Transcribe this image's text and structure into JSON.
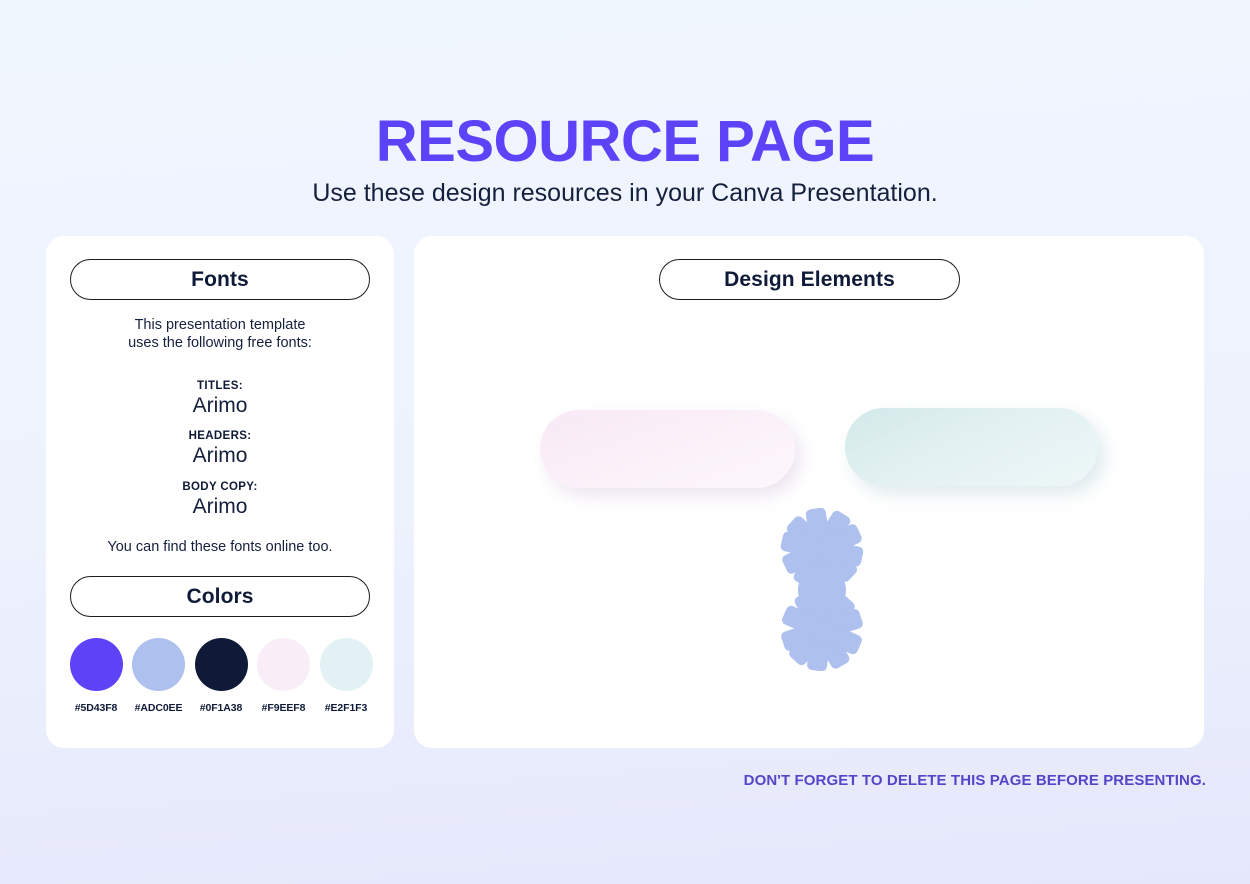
{
  "header": {
    "title": "RESOURCE PAGE",
    "subtitle": "Use these design resources in your Canva Presentation."
  },
  "fonts_card": {
    "heading": "Fonts",
    "intro": "This presentation template\nuses the following free fonts:",
    "groups": [
      {
        "label": "TITLES:",
        "value": "Arimo"
      },
      {
        "label": "HEADERS:",
        "value": "Arimo"
      },
      {
        "label": "BODY COPY:",
        "value": "Arimo"
      }
    ],
    "outro": "You can find these fonts online too."
  },
  "colors_card": {
    "heading": "Colors",
    "swatches": [
      {
        "hex": "#5D43F8",
        "label": "#5D43F8"
      },
      {
        "hex": "#ADC0EE",
        "label": "#ADC0EE"
      },
      {
        "hex": "#0F1A38",
        "label": "#0F1A38"
      },
      {
        "hex": "#F9EEF8",
        "label": "#F9EEF8"
      },
      {
        "hex": "#E2F1F3",
        "label": "#E2F1F3"
      }
    ]
  },
  "design_card": {
    "heading": "Design Elements",
    "shapes": [
      {
        "name": "pink-pill",
        "color": "#F9EEF8"
      },
      {
        "name": "teal-pill",
        "color": "#E2F1F3"
      },
      {
        "name": "asterisk-burst",
        "color": "#ADC0EE"
      }
    ]
  },
  "footer": {
    "note": "DON'T FORGET TO DELETE THIS PAGE BEFORE PRESENTING."
  },
  "theme": {
    "accent": "#5D43F8",
    "text_dark": "#0F1A38",
    "footer_purple": "#5346C8",
    "card_bg": "#FFFFFF"
  }
}
